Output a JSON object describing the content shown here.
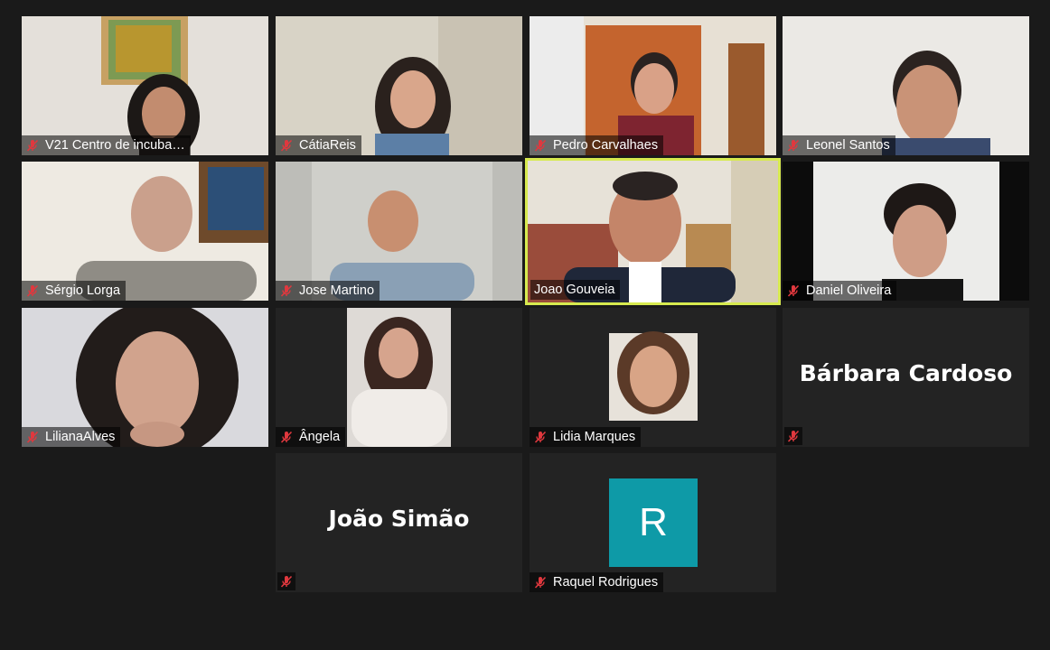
{
  "app": {
    "background": "#1a1a1a",
    "tile_background": "#232323",
    "active_speaker_color": "#d7ea4f",
    "mute_icon_color": "#e0383e"
  },
  "participants": [
    {
      "name": "V21 Centro de incuba…",
      "muted": true,
      "video": true
    },
    {
      "name": "CátiaReis",
      "muted": true,
      "video": true
    },
    {
      "name": "Pedro Carvalhaes",
      "muted": true,
      "video": true
    },
    {
      "name": "Leonel Santos",
      "muted": true,
      "video": true
    },
    {
      "name": "Sérgio Lorga",
      "muted": true,
      "video": true
    },
    {
      "name": "Jose Martino",
      "muted": true,
      "video": true
    },
    {
      "name": "Joao Gouveia",
      "muted": false,
      "video": true,
      "active_speaker": true
    },
    {
      "name": "Daniel Oliveira",
      "muted": true,
      "video": true
    },
    {
      "name": "LilianaAlves",
      "muted": true,
      "video": true
    },
    {
      "name": "Ângela",
      "muted": true,
      "video": true
    },
    {
      "name": "Lidia Marques",
      "muted": true,
      "video": true
    },
    {
      "name": "Bárbara Cardoso",
      "muted": true,
      "video": false
    },
    {
      "name": "João Simão",
      "muted": true,
      "video": false
    },
    {
      "name": "Raquel Rodrigues",
      "muted": true,
      "video": false,
      "avatar_letter": "R",
      "avatar_color": "#0e9aa7"
    }
  ]
}
